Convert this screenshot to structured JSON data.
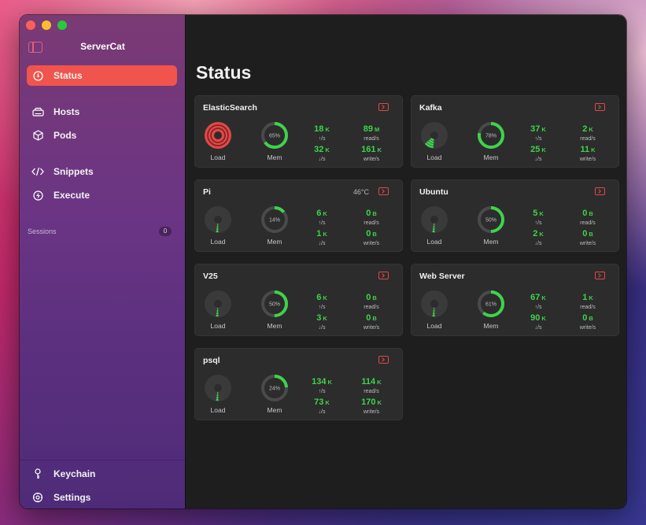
{
  "app": {
    "title": "ServerCat"
  },
  "sidebar": {
    "items": [
      {
        "label": "Status",
        "icon": "status-icon",
        "active": true
      },
      {
        "label": "Hosts",
        "icon": "hosts-icon"
      },
      {
        "label": "Pods",
        "icon": "box-icon"
      },
      {
        "label": "Snippets",
        "icon": "code-icon"
      },
      {
        "label": "Execute",
        "icon": "bolt-icon"
      }
    ],
    "sessions_label": "Sessions",
    "sessions_count": "0",
    "bottom": [
      {
        "label": "Keychain",
        "icon": "key-icon"
      },
      {
        "label": "Settings",
        "icon": "gear-icon"
      }
    ]
  },
  "main": {
    "title": "Status"
  },
  "labels": {
    "load": "Load",
    "mem": "Mem",
    "up": "↑/s",
    "down": "↓/s",
    "read": "read/s",
    "write": "write/s"
  },
  "colors": {
    "accent": "#f0544c",
    "green": "#3fd24c",
    "red": "#e04848",
    "gray": "#9a9a9a"
  },
  "servers": [
    {
      "name": "ElasticSearch",
      "temp": "",
      "load": 1.0,
      "load_color": "red",
      "mem_pct": "65%",
      "mem": 0.65,
      "up": "18",
      "up_u": "K",
      "down": "32",
      "down_u": "K",
      "read": "89",
      "read_u": "M",
      "write": "161",
      "write_u": "K"
    },
    {
      "name": "Kafka",
      "temp": "",
      "load": 0.35,
      "load_color": "green",
      "mem_pct": "78%",
      "mem": 0.78,
      "up": "37",
      "up_u": "K",
      "down": "25",
      "down_u": "K",
      "read": "2",
      "read_u": "K",
      "write": "11",
      "write_u": "K"
    },
    {
      "name": "Pi",
      "temp": "46°C",
      "load": 0.12,
      "load_color": "green",
      "mem_pct": "14%",
      "mem": 0.14,
      "up": "6",
      "up_u": "K",
      "down": "1",
      "down_u": "K",
      "read": "0",
      "read_u": "B",
      "write": "0",
      "write_u": "B"
    },
    {
      "name": "Ubuntu",
      "temp": "",
      "load": 0.12,
      "load_color": "green",
      "mem_pct": "50%",
      "mem": 0.5,
      "up": "5",
      "up_u": "K",
      "down": "2",
      "down_u": "K",
      "read": "0",
      "read_u": "B",
      "write": "0",
      "write_u": "B"
    },
    {
      "name": "V25",
      "temp": "",
      "load": 0.12,
      "load_color": "green",
      "mem_pct": "50%",
      "mem": 0.5,
      "up": "6",
      "up_u": "K",
      "down": "3",
      "down_u": "K",
      "read": "0",
      "read_u": "B",
      "write": "0",
      "write_u": "B"
    },
    {
      "name": "Web Server",
      "temp": "",
      "load": 0.12,
      "load_color": "green",
      "mem_pct": "61%",
      "mem": 0.61,
      "up": "67",
      "up_u": "K",
      "down": "90",
      "down_u": "K",
      "read": "1",
      "read_u": "K",
      "write": "0",
      "write_u": "B"
    },
    {
      "name": "psql",
      "temp": "",
      "load": 0.12,
      "load_color": "green",
      "mem_pct": "24%",
      "mem": 0.24,
      "up": "134",
      "up_u": "K",
      "down": "73",
      "down_u": "K",
      "read": "114",
      "read_u": "K",
      "write": "170",
      "write_u": "K"
    }
  ]
}
